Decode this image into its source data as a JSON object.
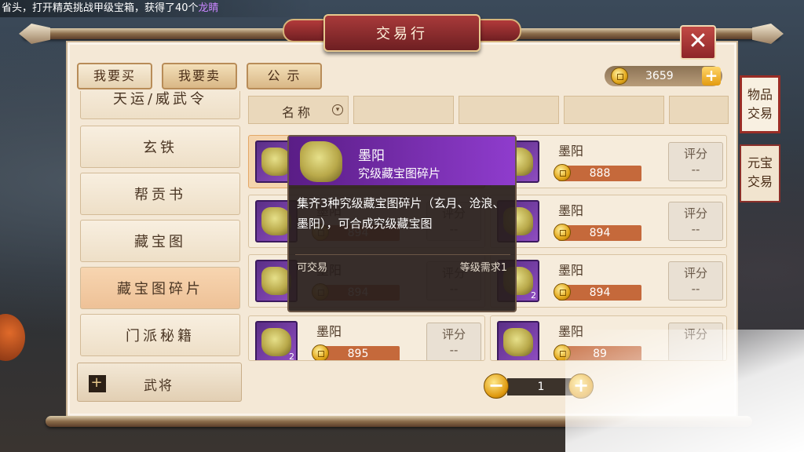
{
  "announcement": {
    "prefix": "省头，打开精英挑战甲级宝箱，获得了40个",
    "item": "龙睛"
  },
  "window": {
    "title": "交易行",
    "close_label": "✕"
  },
  "tabs": [
    {
      "label": "我要买"
    },
    {
      "label": "我要卖"
    },
    {
      "label": "公 示"
    }
  ],
  "currency": {
    "amount": "3659",
    "add_label": "+"
  },
  "side_tabs": [
    {
      "label": "物品交易"
    },
    {
      "label": "元宝交易"
    }
  ],
  "categories": [
    {
      "label": "天运/威武令"
    },
    {
      "label": "玄铁"
    },
    {
      "label": "帮贡书"
    },
    {
      "label": "藏宝图"
    },
    {
      "label": "藏宝图碎片"
    },
    {
      "label": "门派秘籍"
    }
  ],
  "general_button": {
    "icon_label": "+",
    "label": "武将"
  },
  "table_header": {
    "name_label": "名称",
    "sort_icon": "chevron-down-icon"
  },
  "listings": [
    {
      "name": "墨阳",
      "price": "888",
      "rate": "评分",
      "score": "--",
      "qty": ""
    },
    {
      "name": "墨阳",
      "price": "888",
      "rate": "评分",
      "score": "--",
      "qty": ""
    },
    {
      "name": "墨阳",
      "price": "894",
      "rate": "评分",
      "score": "--",
      "qty": ""
    },
    {
      "name": "墨阳",
      "price": "894",
      "rate": "评分",
      "score": "--",
      "qty": ""
    },
    {
      "name": "墨阳",
      "price": "894",
      "rate": "评分",
      "score": "--",
      "qty": ""
    },
    {
      "name": "墨阳",
      "price": "894",
      "rate": "评分",
      "score": "--",
      "qty": "2"
    },
    {
      "name": "墨阳",
      "price": "895",
      "rate": "评分",
      "score": "--",
      "qty": "2"
    },
    {
      "name": "墨阳",
      "price": "89",
      "rate": "评分",
      "score": "",
      "qty": ""
    }
  ],
  "tooltip": {
    "name": "墨阳",
    "subtitle": "究级藏宝图碎片",
    "description": "集齐3种究级藏宝图碎片（玄月、沧浪、墨阳），可合成究级藏宝图",
    "tradable": "可交易",
    "level_req": "等级需求1"
  },
  "quantity": {
    "value": "1",
    "minus_label": "−",
    "plus_label": "+"
  },
  "colors": {
    "accent_red": "#8e2528",
    "panel": "#f4e8d6",
    "tooltip_purple": "#8f3ccd",
    "price_orange": "#c5693b"
  }
}
